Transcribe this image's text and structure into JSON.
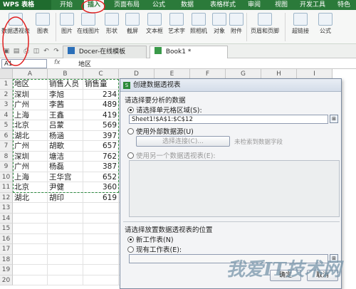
{
  "app": {
    "name": "WPS 表格"
  },
  "menu": [
    "开始",
    "插入",
    "页面布局",
    "公式",
    "数据",
    "表格样式",
    "审阅",
    "视图",
    "开发工具",
    "特色"
  ],
  "ribbon": [
    "数据透视表",
    "图表",
    "图片",
    "在线图片",
    "形状",
    "截屏",
    "文本框",
    "艺术字",
    "照相机",
    "对象",
    "附件",
    "页眉和页脚",
    "超链接",
    "公式"
  ],
  "tabs": [
    {
      "label": "Docer-在线模板",
      "active": false
    },
    {
      "label": "Book1 *",
      "active": true
    }
  ],
  "formula_bar": {
    "cell_ref": "A1",
    "fx": "fx",
    "value": "地区"
  },
  "columns": [
    "A",
    "B",
    "C",
    "D",
    "E",
    "F",
    "G",
    "H",
    "I"
  ],
  "rows": [
    [
      "1",
      "地区",
      "销售人员",
      "销售量"
    ],
    [
      "2",
      "深圳",
      "李旭",
      "234"
    ],
    [
      "3",
      "广州",
      "李茜",
      "489"
    ],
    [
      "4",
      "上海",
      "王鑫",
      "419"
    ],
    [
      "5",
      "北京",
      "吕蒙",
      "569"
    ],
    [
      "6",
      "湖北",
      "杨涵",
      "397"
    ],
    [
      "7",
      "广州",
      "胡歌",
      "657"
    ],
    [
      "8",
      "深圳",
      "塘洁",
      "762"
    ],
    [
      "9",
      "广州",
      "杨磊",
      "387"
    ],
    [
      "10",
      "上海",
      "王华宫",
      "652"
    ],
    [
      "11",
      "北京",
      "尹健",
      "360"
    ],
    [
      "12",
      "湖北",
      "胡印",
      "619"
    ],
    [
      "13",
      "",
      "",
      ""
    ],
    [
      "14",
      "",
      "",
      ""
    ],
    [
      "15",
      "",
      "",
      ""
    ],
    [
      "16",
      "",
      "",
      ""
    ],
    [
      "17",
      "",
      "",
      ""
    ],
    [
      "18",
      "",
      "",
      ""
    ],
    [
      "19",
      "",
      "",
      ""
    ],
    [
      "20",
      "",
      "",
      ""
    ]
  ],
  "dialog": {
    "title": "创建数据透视表",
    "section1": "请选择要分析的数据",
    "opt_range": "请选择单元格区域(S):",
    "range_value": "Sheet1!$A$1:$C$12",
    "opt_external": "使用外部数据源(U)",
    "choose_conn": "选择连接(C)...",
    "no_fields": "未检索到数据字段",
    "opt_other_pivot": "使用另一个数据透视表(E):",
    "section2": "请选择放置数据透视表的位置",
    "opt_new_sheet": "新工作表(N)",
    "opt_existing_sheet": "现有工作表(E):",
    "ok": "确定",
    "cancel": "取消"
  },
  "watermark": "我爱IT技术网",
  "colors": {
    "accent": "#2b7a3a",
    "annotation": "#e02020"
  }
}
